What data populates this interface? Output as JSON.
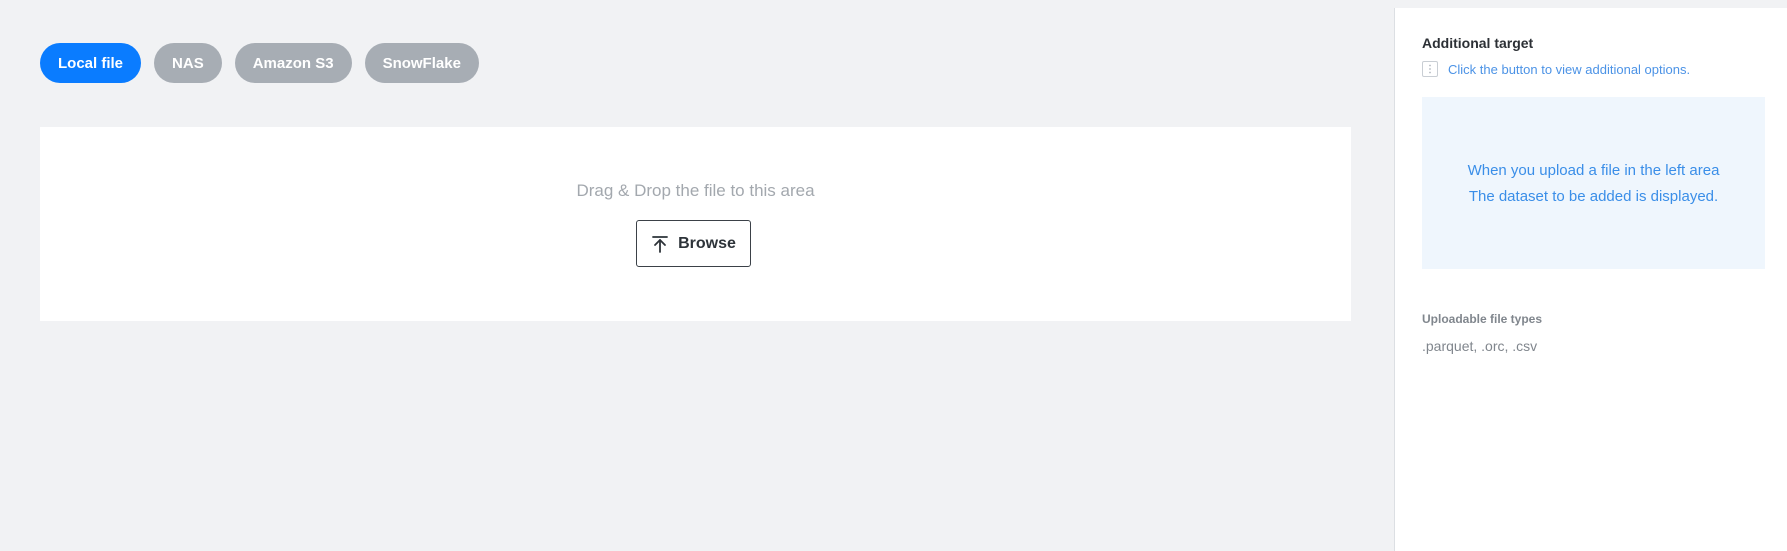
{
  "source_tabs": [
    {
      "label": "Local file",
      "active": true
    },
    {
      "label": "NAS",
      "active": false
    },
    {
      "label": "Amazon S3",
      "active": false
    },
    {
      "label": "SnowFlake",
      "active": false
    }
  ],
  "dropzone": {
    "hint": "Drag & Drop the file to this area",
    "browse_label": "Browse",
    "browse_icon": "upload-icon"
  },
  "side_panel": {
    "title": "Additional target",
    "options_icon": "kebab-icon",
    "options_text": "Click the button to view additional options.",
    "info_lines": [
      "When you upload a file in the left area",
      "The dataset to be added is displayed."
    ],
    "filetypes_label": "Uploadable file types",
    "filetypes_value": ".parquet, .orc, .csv"
  },
  "colors": {
    "accent": "#0a7cff",
    "inactive_pill": "#a7adb4",
    "info_text": "#3a8ee8",
    "info_bg": "#eff6fd",
    "background": "#f1f2f4"
  }
}
